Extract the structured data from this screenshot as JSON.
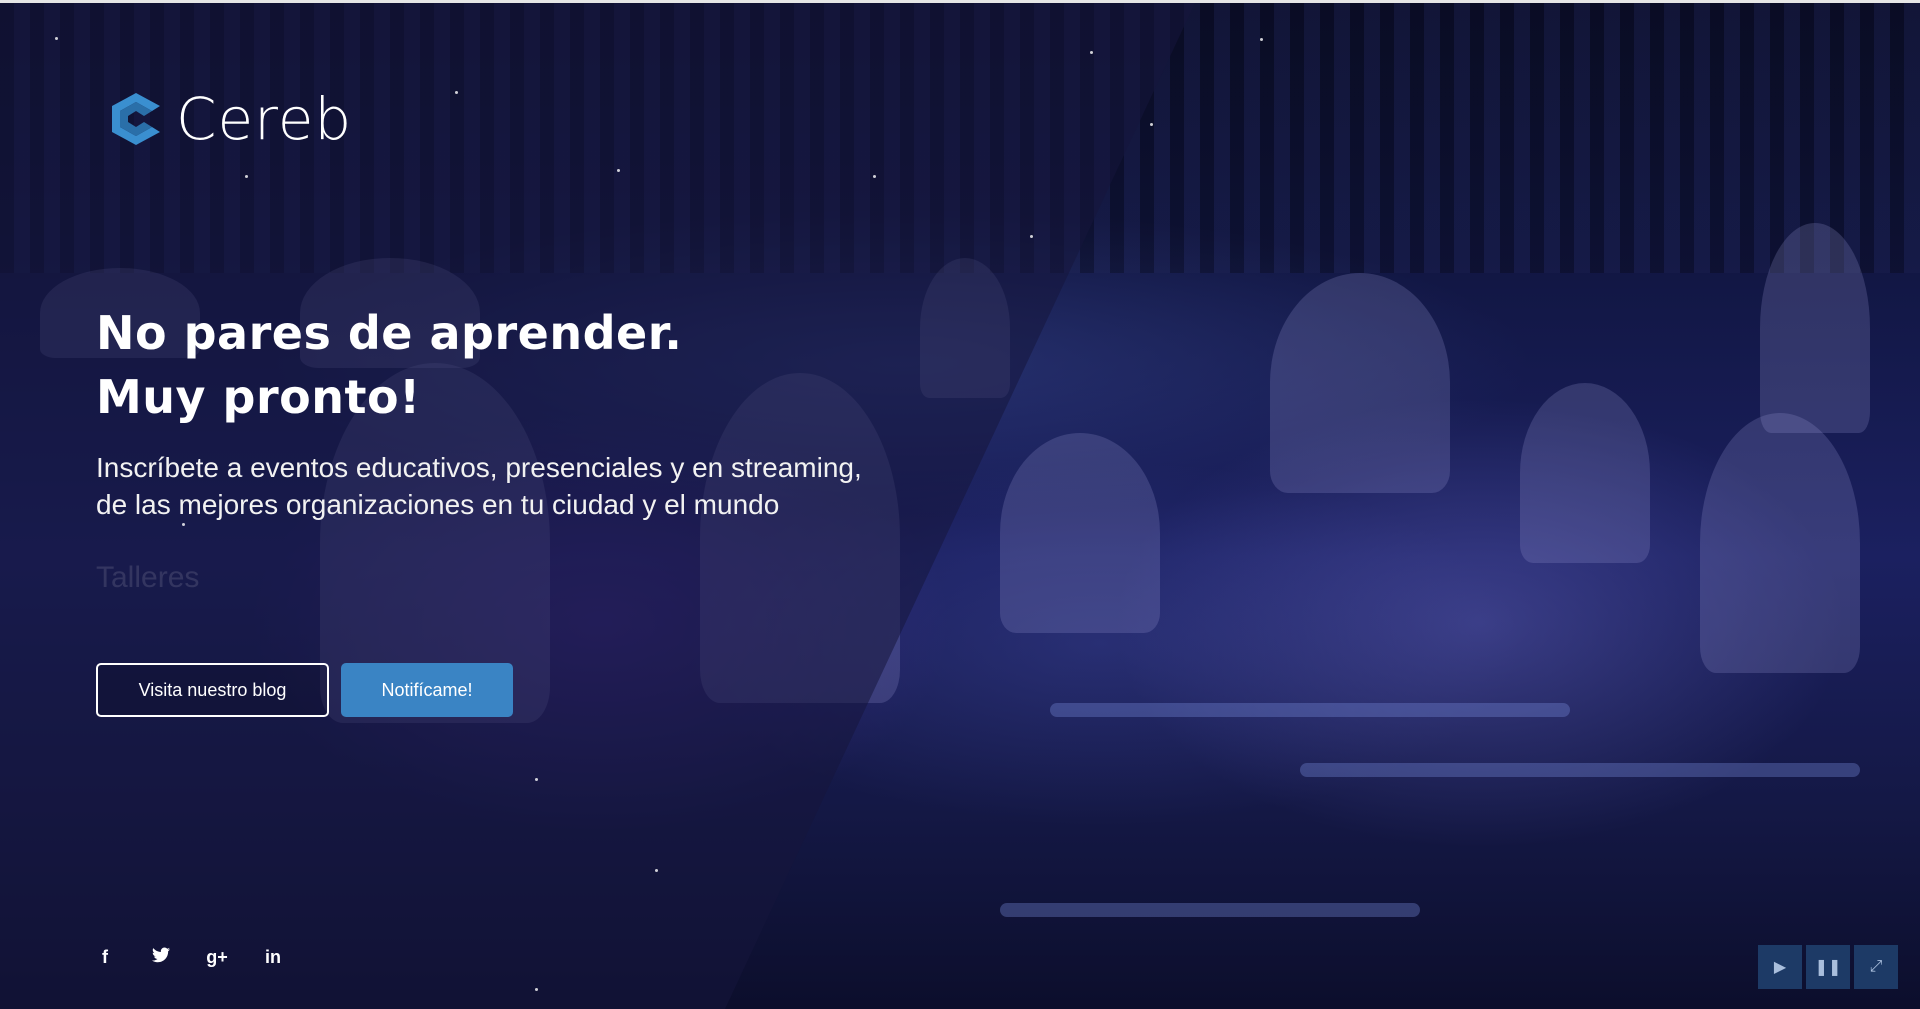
{
  "brand": {
    "name": "Cereb",
    "logo_icon": "cereb-logo-icon",
    "accent": "#3a84c4"
  },
  "hero": {
    "headline_line1": "No pares de aprender.",
    "headline_line2": "Muy pronto!",
    "subtitle": "Inscríbete a eventos educativos, presenciales y en streaming, de las mejores organizaciones en tu ciudad y el mundo",
    "rotating_word": "Talleres"
  },
  "buttons": {
    "blog_label": "Visita nuestro blog",
    "notify_label": "Notifícame!"
  },
  "social": [
    {
      "name": "facebook-icon",
      "glyph": "f"
    },
    {
      "name": "twitter-icon",
      "glyph": "🐦"
    },
    {
      "name": "google-plus-icon",
      "glyph": "g+"
    },
    {
      "name": "linkedin-icon",
      "glyph": "in"
    }
  ],
  "video_controls": [
    {
      "name": "play-icon",
      "glyph": "▶"
    },
    {
      "name": "pause-icon",
      "glyph": "❚❚"
    },
    {
      "name": "fullscreen-icon",
      "glyph": "⤢"
    }
  ]
}
